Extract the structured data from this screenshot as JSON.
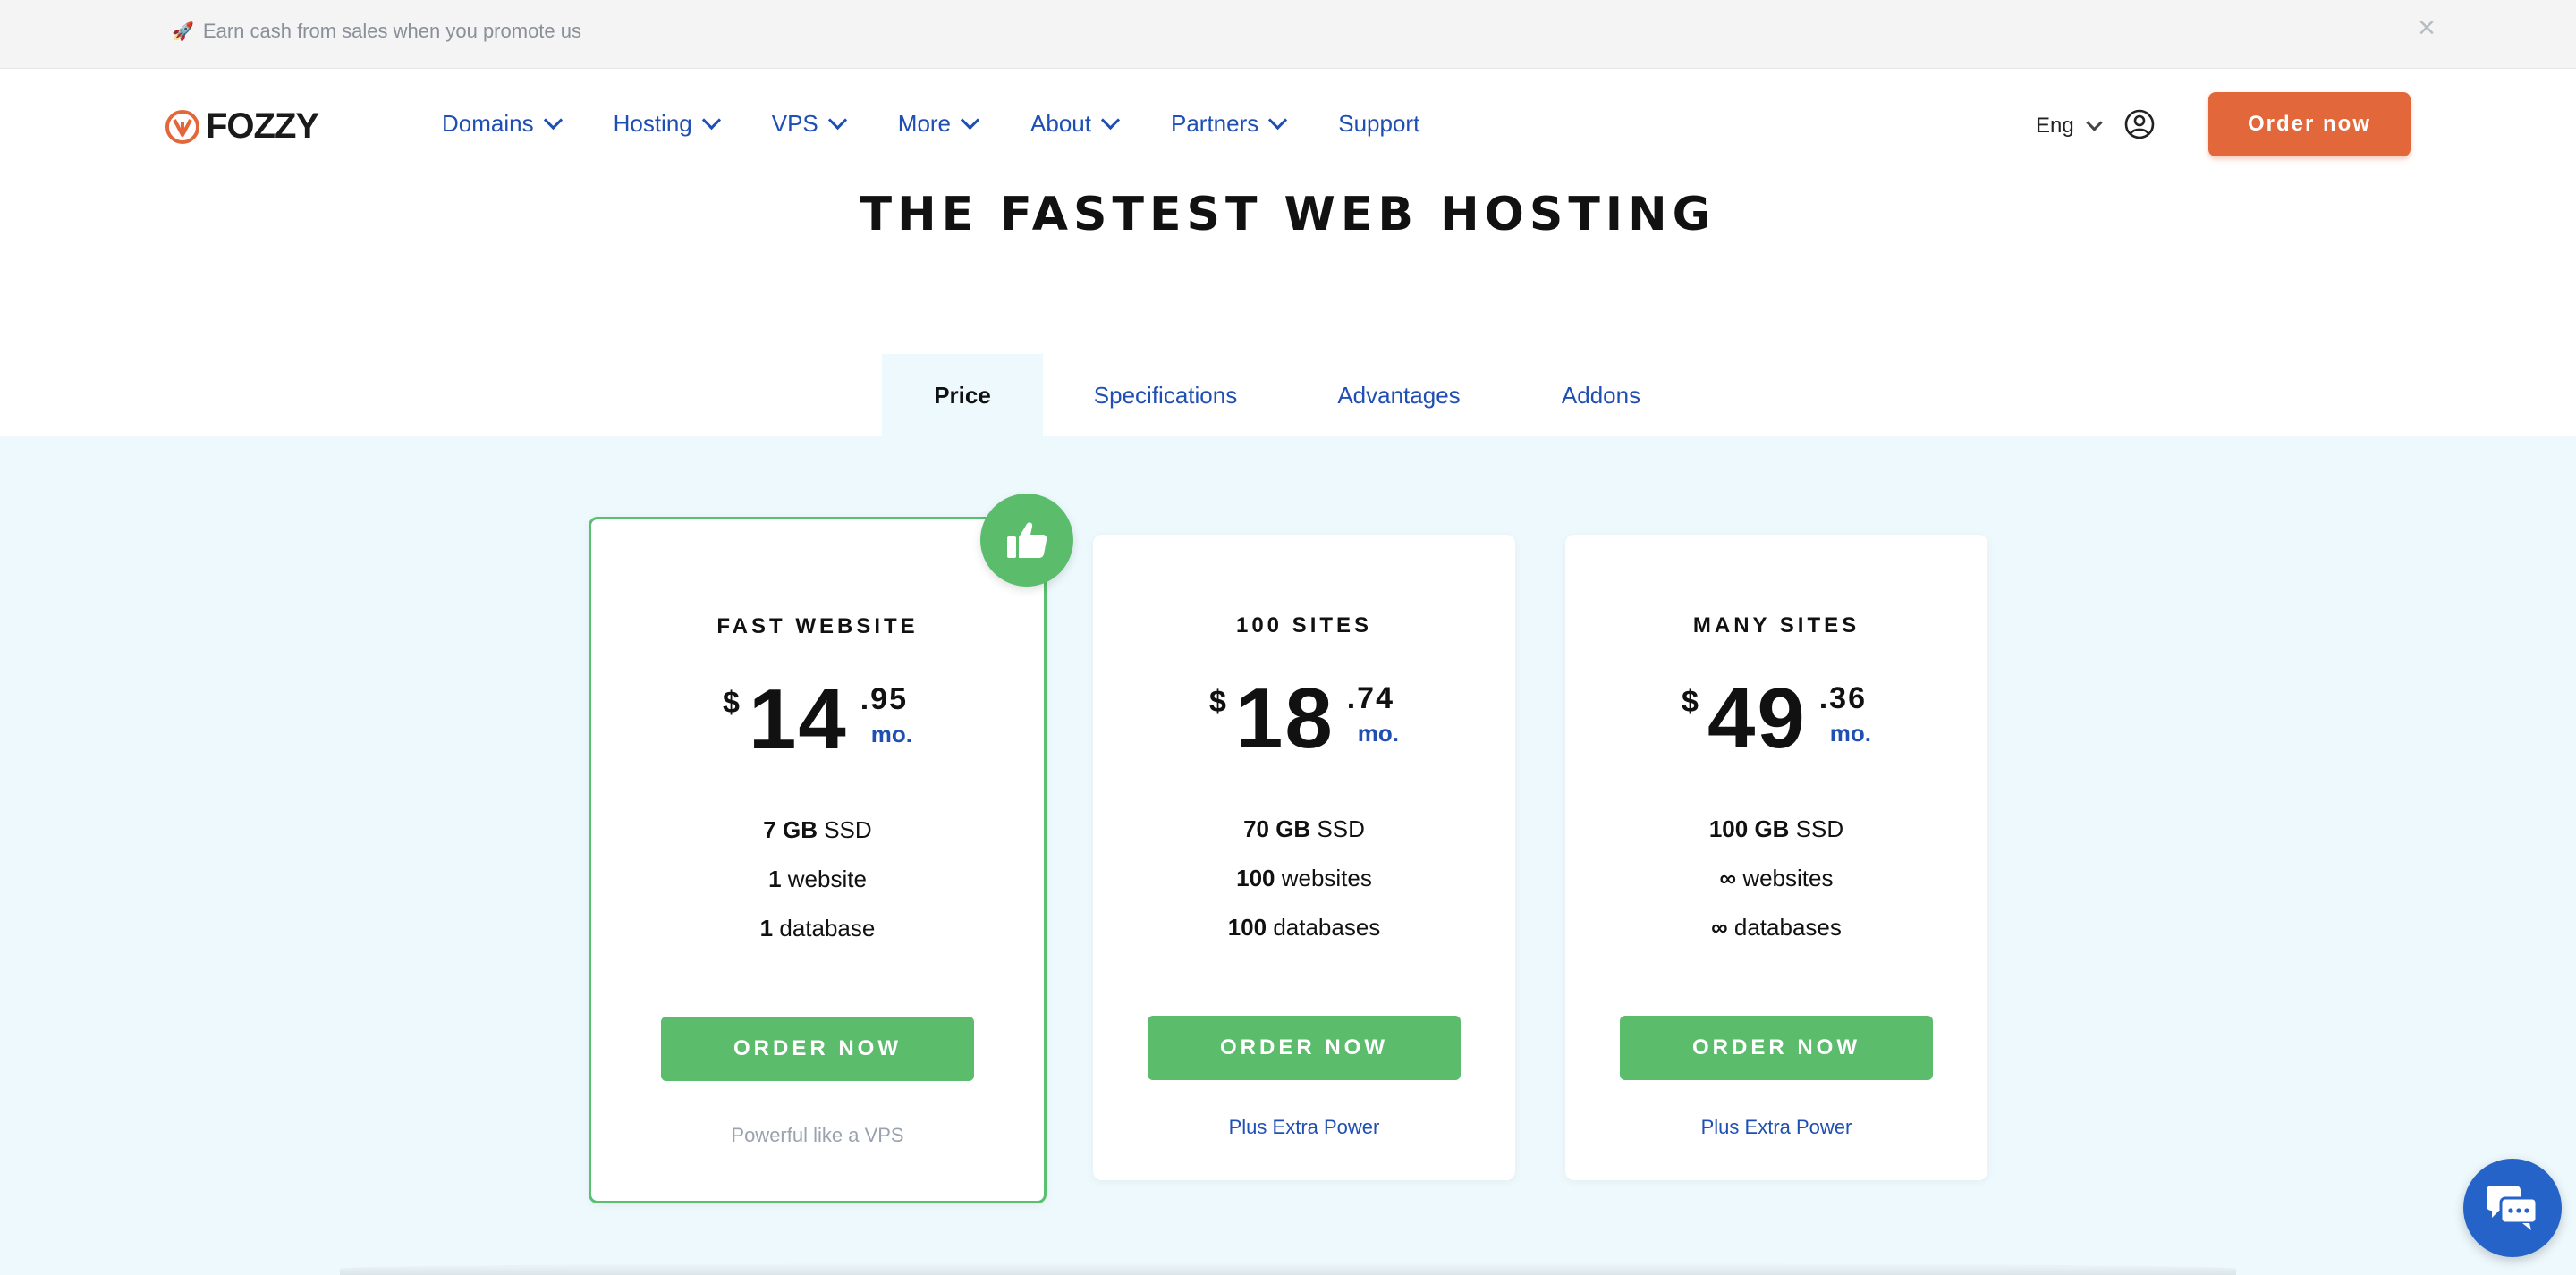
{
  "promo": {
    "emoji": "🚀",
    "text": "Earn cash from sales when you promote us",
    "close": "×"
  },
  "header": {
    "logo_text": "FOZZY",
    "nav": [
      {
        "label": "Domains",
        "dropdown": true
      },
      {
        "label": "Hosting",
        "dropdown": true
      },
      {
        "label": "VPS",
        "dropdown": true
      },
      {
        "label": "More",
        "dropdown": true
      },
      {
        "label": "About",
        "dropdown": true
      },
      {
        "label": "Partners",
        "dropdown": true
      },
      {
        "label": "Support",
        "dropdown": false
      }
    ],
    "language": "Eng",
    "order_button": "Order now"
  },
  "page": {
    "title": "THE FASTEST WEB HOSTING"
  },
  "tabs": [
    {
      "label": "Price",
      "active": true
    },
    {
      "label": "Specifications",
      "active": false
    },
    {
      "label": "Advantages",
      "active": false
    },
    {
      "label": "Addons",
      "active": false
    }
  ],
  "plans": [
    {
      "name": "FAST WEBSITE",
      "currency": "$",
      "price_int": "14",
      "price_cents": ".95",
      "period": "mo.",
      "features": [
        {
          "value": "7 GB",
          "label": "SSD"
        },
        {
          "value": "1",
          "label": "website"
        },
        {
          "value": "1",
          "label": "database"
        }
      ],
      "order_label": "ORDER NOW",
      "footer": "Powerful like a VPS",
      "featured": true
    },
    {
      "name": "100 SITES",
      "currency": "$",
      "price_int": "18",
      "price_cents": ".74",
      "period": "mo.",
      "features": [
        {
          "value": "70 GB",
          "label": "SSD"
        },
        {
          "value": "100",
          "label": "websites"
        },
        {
          "value": "100",
          "label": "databases"
        }
      ],
      "order_label": "ORDER NOW",
      "footer": "Plus Extra Power",
      "featured": false
    },
    {
      "name": "MANY SITES",
      "currency": "$",
      "price_int": "49",
      "price_cents": ".36",
      "period": "mo.",
      "features": [
        {
          "value": "100 GB",
          "label": "SSD"
        },
        {
          "value": "∞",
          "label": "websites"
        },
        {
          "value": "∞",
          "label": "databases"
        }
      ],
      "order_label": "ORDER NOW",
      "footer": "Plus Extra Power",
      "featured": false
    }
  ],
  "colors": {
    "accent_orange": "#e2673a",
    "link_blue": "#1f4fb3",
    "green": "#5bbd6c",
    "pricing_bg": "#eef9fd",
    "chat_blue": "#2563c9"
  },
  "icons": {
    "logo": "fozzy-logo-icon",
    "user": "user-circle-icon",
    "featured": "thumbs-up-icon",
    "chat": "chat-icon"
  }
}
